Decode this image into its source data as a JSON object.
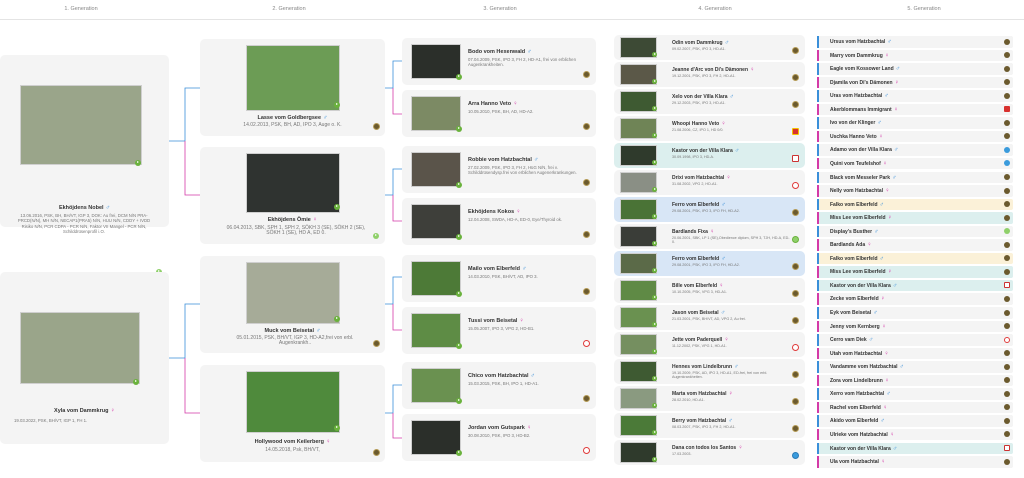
{
  "generations": [
    "1. Generation",
    "2. Generation",
    "3. Generation",
    "4. Generation",
    "5. Generation"
  ],
  "g1": [
    {
      "name": "Ekhöjdens Nobel",
      "sex": "♂",
      "info": "13.06.2016, PSK, BH, BH/VT, IGP 3, DOK: Au frei, DCM N/N PRA-PRCD(N/N), MH N/N, NECAP1(PRA5) N/N, HUU N/N, CDDY + IVDD Risiko N/N, PCR CDPA - PCR N/N, Faktor VII Mangel - PCR N/N, Schilddrüsenprofil i.O."
    },
    {
      "name": "Xyla vom Dammkrug",
      "sex": "♀",
      "info": "19.03.2022, PSK, BH/VT, IGP 1, FH 1."
    }
  ],
  "g2": [
    {
      "name": "Lasse vom Goldbergsee",
      "sex": "♂",
      "info": "14.02.2013, PSK, BH, AD, IPO 3, Auge o. K."
    },
    {
      "name": "Ekhöjdens Ömie",
      "sex": "♀",
      "info": "06.04.2013, SBK, SPH 1, SPH 2, SÖKH 3 (SE), SÖKH 2 (SE), SÖKH 1 (SE), HD A, ED 0."
    },
    {
      "name": "Muck vom Beisetal",
      "sex": "♂",
      "info": "05.01.2015, PSK, BH/VT, IGP 3, HD-A2,frei von erbl. Augenkrankh.."
    },
    {
      "name": "Hollywood vom Keilerberg",
      "sex": "♀",
      "info": "14.05.2018, Psk, BH/VT,"
    }
  ],
  "g3": [
    {
      "name": "Bodo vom Hexenwald",
      "sex": "♂",
      "info": "07.04.2009, PSK, IPO 3, FH 2, HD-A1, frei von erblichen Augenkrankheiten."
    },
    {
      "name": "Arra Hanno Veto",
      "sex": "♀",
      "info": "10.05.2010, PSK, BH, AD, HD-A2."
    },
    {
      "name": "Robbie vom Hatzbachtal",
      "sex": "♂",
      "info": "27.02.2009, PSK, IPO 3, FH 2, HüG N/N, frei v. Schilddrüsendysp.frei von erblichen Augenerkrankungen."
    },
    {
      "name": "Ekhöjdens Kokos",
      "sex": "♀",
      "info": "12.04.2008, SWDA, HD-A, ED-0, Eye/Thyroid ok."
    },
    {
      "name": "Mailo vom Elberfeld",
      "sex": "♂",
      "info": "14.03.2010, PSK, BH/VT, AD, IPO 3."
    },
    {
      "name": "Tussi vom Beisetal",
      "sex": "♀",
      "info": "15.05.2007, IPO 3, VPG 2, HD-B1."
    },
    {
      "name": "Chico vom Hatzbachtal",
      "sex": "♂",
      "info": "15.03.2015, PSK, BH, IPO 1, HD-A1."
    },
    {
      "name": "Jordan vom Gutspark",
      "sex": "♀",
      "info": "30.08.2010, PSK, IPO 3, HD-B2."
    }
  ],
  "g4": [
    {
      "name": "Odin vom Dammkrug",
      "sex": "♂",
      "info": "09.02.2007, PSK, IPO 3, HD-A1."
    },
    {
      "name": "Jeanne d'Arc von Di's Dämonen",
      "sex": "♀",
      "info": "19.12.2001, PSK, IPO 3, FH 2, HD-A1."
    },
    {
      "name": "Xelo von der Villa Klara",
      "sex": "♂",
      "info": "29.12.2003, PSK, IPO 3, HD-A1."
    },
    {
      "name": "Whoopi Hanno Veto",
      "sex": "♀",
      "info": "21.08.2006, CZ, IPO 1, HD 0/0."
    },
    {
      "name": "Kastor von der Villa Klara",
      "sex": "♂",
      "info": "30.09.1998, IPO 3, HD-A."
    },
    {
      "name": "Drixi vom Hatzbachtal",
      "sex": "♀",
      "info": "31.08.2002, VPG 2, HD-A1."
    },
    {
      "name": "Ferro vom Elberfeld",
      "sex": "♂",
      "info": "29.08.2001, PSK, IPO 3, IPO FH, HD-A2."
    },
    {
      "name": "Bardlands Fixa",
      "sex": "♀",
      "info": "20.06.2001, SBK, LP 1 (SE),Obedience diplom, SPH 3, TJH, HD-A, ED-0."
    },
    {
      "name": "Ferro vom Elberfeld",
      "sex": "♂",
      "info": "29.08.2001, PSK, IPO 3, IPO FH, HD-A2."
    },
    {
      "name": "Bille vom Elberfeld",
      "sex": "♀",
      "info": "10.10.2005, PSK, VPG 3, HD-A1."
    },
    {
      "name": "Jason vom Beisetal",
      "sex": "♂",
      "info": "21.03.2001, PSK, BH/VT, AD, VPG 2, Au frei."
    },
    {
      "name": "Jette vom Paderquell",
      "sex": "♀",
      "info": "11.12.2002, PSK, VPG 1, HD-A1."
    },
    {
      "name": "Hennes vom Lindelbrunn",
      "sex": "♂",
      "info": "19.10.2009, PSK, AD, IPO 3, HD-A1, ED-frei, frei von erbl. Augenkrankheiten."
    },
    {
      "name": "Marta vom Hatzbachtal",
      "sex": "♀",
      "info": "28.02.2010, HD-A1."
    },
    {
      "name": "Berry vom Hatzbachtal",
      "sex": "♂",
      "info": "08.03.2007, PSK, IPO 3, FH 2, HD-A1."
    },
    {
      "name": "Dana con todos los Santos",
      "sex": "♀",
      "info": "17.03.2003."
    }
  ],
  "g5": [
    {
      "name": "Ursus vom Hatzbachtal",
      "sex": "♂"
    },
    {
      "name": "Marry vom Dammkrug",
      "sex": "♀"
    },
    {
      "name": "Eagle vom Kossower Land",
      "sex": "♂"
    },
    {
      "name": "Djamila von Di's Dämonen",
      "sex": "♀"
    },
    {
      "name": "Uras vom Hatzbachtal",
      "sex": "♂"
    },
    {
      "name": "Akerblommans Immigrant",
      "sex": "♀"
    },
    {
      "name": "Ivo von der Klinger",
      "sex": "♂"
    },
    {
      "name": "Uschka Hanno Veto",
      "sex": "♀"
    },
    {
      "name": "Adamo von der Villa Klara",
      "sex": "♂"
    },
    {
      "name": "Quini vom Teufelshof",
      "sex": "♀"
    },
    {
      "name": "Black vom Messeler Park",
      "sex": "♂"
    },
    {
      "name": "Nelly vom Hatzbachtal",
      "sex": "♀"
    },
    {
      "name": "Falko vom Elberfeld",
      "sex": "♂"
    },
    {
      "name": "Miss Lee vom Elberfeld",
      "sex": "♀"
    },
    {
      "name": "Display's Busther",
      "sex": "♂"
    },
    {
      "name": "Bardlands Ada",
      "sex": "♀"
    },
    {
      "name": "Falko vom Elberfeld",
      "sex": "♂"
    },
    {
      "name": "Miss Lee vom Elberfeld",
      "sex": "♀"
    },
    {
      "name": "Kastor von der Villa Klara",
      "sex": "♂"
    },
    {
      "name": "Zecke vom Elberfeld",
      "sex": "♀"
    },
    {
      "name": "Eyk vom Beisetal",
      "sex": "♂"
    },
    {
      "name": "Jenny vom Kernberg",
      "sex": "♀"
    },
    {
      "name": "Cerro vam Diek",
      "sex": "♂"
    },
    {
      "name": "Utah vom Hatzbachtal",
      "sex": "♀"
    },
    {
      "name": "Vandamme vom Hatzbachtal",
      "sex": "♂"
    },
    {
      "name": "Zora vom Lindelbrunn",
      "sex": "♀"
    },
    {
      "name": "Xerro vom Hatzbachtal",
      "sex": "♂"
    },
    {
      "name": "Rachel vom Elberfeld",
      "sex": "♀"
    },
    {
      "name": "Akido vom Elberfeld",
      "sex": "♂"
    },
    {
      "name": "Ulrieke vom Hatzbachtal",
      "sex": "♀"
    },
    {
      "name": "Kastor von der Villa Klara",
      "sex": "♂"
    },
    {
      "name": "Ula vom Hatzbachtal",
      "sex": "♀"
    }
  ],
  "highlights": {
    "teal": "#dcefee",
    "blue": "#d8e6f6",
    "yellow": "#fbf1d8",
    "line_male": "#3a8fd9",
    "line_female": "#d43aa8"
  }
}
